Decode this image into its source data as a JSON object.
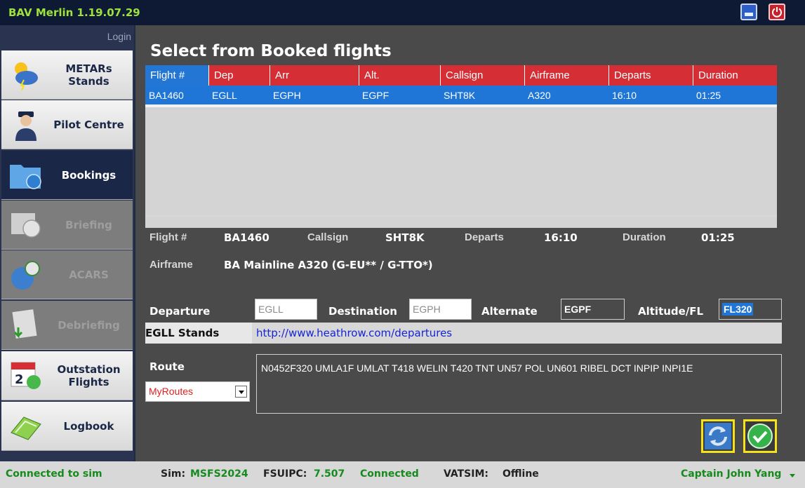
{
  "app": {
    "title": "BAV Merlin 1.19.07.29"
  },
  "colors": {
    "accent_green": "#9ee23b",
    "header_red": "#d62e35",
    "selection_blue": "#1f76d6",
    "status_green": "#178a1e"
  },
  "sidebar": {
    "login_label": "Login",
    "items": [
      {
        "label": "METARs Stands",
        "icon": "weather-icon",
        "state": "normal"
      },
      {
        "label": "Pilot Centre",
        "icon": "pilot-icon",
        "state": "normal"
      },
      {
        "label": "Bookings",
        "icon": "folder-globe-icon",
        "state": "active"
      },
      {
        "label": "Briefing",
        "icon": "calendar-clock-icon",
        "state": "disabled"
      },
      {
        "label": "ACARS",
        "icon": "globe-clock-icon",
        "state": "disabled"
      },
      {
        "label": "Debriefing",
        "icon": "document-arrow-icon",
        "state": "disabled"
      },
      {
        "label": "Outstation Flights",
        "icon": "calendar-icon",
        "state": "normal"
      },
      {
        "label": "Logbook",
        "icon": "laptop-icon",
        "state": "normal"
      }
    ]
  },
  "main": {
    "title": "Select from Booked flights",
    "grid": {
      "columns": [
        "Flight #",
        "Dep",
        "Arr",
        "Alt.",
        "Callsign",
        "Airframe",
        "Departs",
        "Duration"
      ],
      "rows": [
        [
          "BA1460",
          "EGLL",
          "EGPH",
          "EGPF",
          "SHT8K",
          "A320",
          "16:10",
          "01:25"
        ]
      ]
    },
    "details": {
      "flight_label": "Flight #",
      "flight_value": "BA1460",
      "callsign_label": "Callsign",
      "callsign_value": "SHT8K",
      "departs_label": "Departs",
      "departs_value": "16:10",
      "duration_label": "Duration",
      "duration_value": "01:25",
      "airframe_label": "Airframe",
      "airframe_value": "BA Mainline A320 (G-EU** / G-TTO*)"
    },
    "form": {
      "departure_label": "Departure",
      "departure_value": "EGLL",
      "destination_label": "Destination",
      "destination_value": "EGPH",
      "alternate_label": "Alternate",
      "alternate_value": "EGPF",
      "altitude_label": "Altitude/FL",
      "altitude_value": "FL320",
      "stands_label": "EGLL Stands",
      "stands_link": "http://www.heathrow.com/departures",
      "route_label": "Route",
      "route_source": "MyRoutes",
      "route_text": "N0452F320 UMLA1F UMLAT T418 WELIN T420 TNT UN57 POL UN601 RIBEL DCT INPIP INPI1E"
    }
  },
  "status": {
    "connection": "Connected to sim",
    "sim_label": "Sim:",
    "sim_value": "MSFS2024",
    "fsuipc_label": "FSUIPC:",
    "fsuipc_value": "7.507",
    "fsuipc_state": "Connected",
    "vatsim_label": "VATSIM:",
    "vatsim_value": "Offline",
    "user": "Captain John Yang"
  }
}
